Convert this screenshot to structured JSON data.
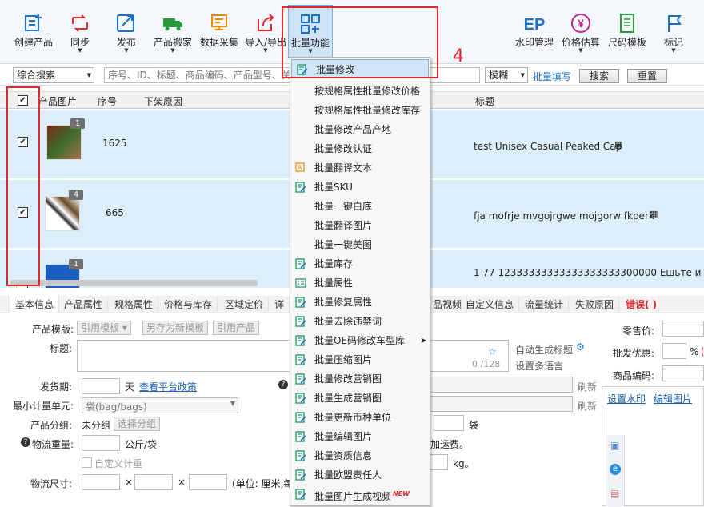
{
  "toolbar": {
    "items": [
      {
        "label": "创建产品",
        "icon": "create-product-icon",
        "dropdown": false
      },
      {
        "label": "同步",
        "icon": "sync-icon",
        "dropdown": true
      },
      {
        "label": "发布",
        "icon": "publish-icon",
        "dropdown": true
      },
      {
        "label": "产品搬家",
        "icon": "truck-icon",
        "dropdown": true
      },
      {
        "label": "数据采集",
        "icon": "data-collect-icon",
        "dropdown": false
      },
      {
        "label": "导入/导出",
        "icon": "import-export-icon",
        "dropdown": true
      },
      {
        "label": "批量功能",
        "icon": "batch-function-icon",
        "dropdown": true
      },
      {
        "label": "水印管理",
        "icon": "watermark-icon",
        "dropdown": false
      },
      {
        "label": "价格估算",
        "icon": "yen-icon",
        "dropdown": true
      },
      {
        "label": "尺码模板",
        "icon": "size-template-icon",
        "dropdown": false
      },
      {
        "label": "标记",
        "icon": "flag-icon",
        "dropdown": true
      }
    ]
  },
  "search": {
    "type_value": "综合搜索",
    "placeholder": "序号、ID、标题、商品编码、产品型号、关",
    "mode_value": "模糊",
    "batch_fill_link": "批量填写",
    "search_button": "搜索",
    "reset_button": "重置"
  },
  "grid": {
    "headers": [
      "产品图片",
      "序号",
      "下架原因",
      "标题"
    ],
    "rows": [
      {
        "checked": true,
        "badge": "1",
        "seq": "1625",
        "title": "test Unisex Casual Peaked Cap"
      },
      {
        "checked": true,
        "badge": "4",
        "seq": "665",
        "title": "fja mofrje mvgojrgwe mojgorw fkperk"
      },
      {
        "checked": false,
        "badge": "1",
        "seq": "",
        "title": "1 77 12333333333333333333300000  Ешьте и"
      }
    ]
  },
  "tabs": [
    {
      "label": "基本信息"
    },
    {
      "label": "产品属性"
    },
    {
      "label": "规格属性"
    },
    {
      "label": "价格与库存"
    },
    {
      "label": "区域定价"
    },
    {
      "label": "详"
    },
    {
      "label": "品视频"
    },
    {
      "label": "自定义信息"
    },
    {
      "label": "流量统计"
    },
    {
      "label": "失败原因"
    },
    {
      "label": "错误( )"
    }
  ],
  "form": {
    "template_label": "产品模版:",
    "ref_template_button": "引用模板",
    "save_template_button": "另存为新模板",
    "ref_product_button": "引用产品",
    "title_label": "标题:",
    "title_counter": "0 /128",
    "auto_title_label": "自动生成标题",
    "multi_lang_label": "设置多语言",
    "delivery_label": "发货期:",
    "delivery_unit": "天",
    "platform_policy_link": "查看平台政策",
    "min_unit_label": "最小计量单元:",
    "min_unit_value": "袋(bag/bags)",
    "group_label": "产品分组:",
    "group_value": "未分组",
    "choose_group_button": "选择分组",
    "weight_label": "物流重量:",
    "weight_unit": "公斤/袋",
    "custom_weight_label": "自定义计重",
    "size_label": "物流尺寸:",
    "size_times1": "×",
    "size_times2": "×",
    "size_unit": "(单位: 厘米,每",
    "refresh1": "刷新",
    "refresh2": "刷新",
    "bag_unit": "袋",
    "shipping_fee_text": "加运费。",
    "kg_unit": "kg。",
    "retail_price_label": "零售价:",
    "wholesale_label": "批发优惠:",
    "percent": "%",
    "percent_paren": "(",
    "product_code_label": "商品编码:",
    "set_watermark_link": "设置水印",
    "edit_image_link": "编辑图片"
  },
  "batch_menu": {
    "items": [
      {
        "label": "批量修改",
        "icon": "edit-doc-icon"
      },
      {
        "label": "按规格属性批量修改价格",
        "icon": ""
      },
      {
        "label": "按规格属性批量修改库存",
        "icon": ""
      },
      {
        "label": "批量修改产品产地",
        "icon": ""
      },
      {
        "label": "批量修改认证",
        "icon": ""
      },
      {
        "label": "批量翻译文本",
        "icon": "translate-icon"
      },
      {
        "label": "批量SKU",
        "icon": "edit-doc-icon"
      },
      {
        "label": "批量一键白底",
        "icon": ""
      },
      {
        "label": "批量翻译图片",
        "icon": ""
      },
      {
        "label": "批量一键美图",
        "icon": ""
      },
      {
        "label": "批量库存",
        "icon": "edit-doc-icon"
      },
      {
        "label": "批量属性",
        "icon": "attribute-icon"
      },
      {
        "label": "批量修复属性",
        "icon": "edit-doc-icon"
      },
      {
        "label": "批量去除违禁词",
        "icon": "edit-doc-icon"
      },
      {
        "label": "批量OE码修改车型库",
        "icon": "edit-doc-icon",
        "submenu": true
      },
      {
        "label": "批量压缩图片",
        "icon": "edit-doc-icon"
      },
      {
        "label": "批量修改营销图",
        "icon": "edit-doc-icon"
      },
      {
        "label": "批量生成营销图",
        "icon": "edit-doc-icon"
      },
      {
        "label": "批量更新币种单位",
        "icon": "edit-doc-icon"
      },
      {
        "label": "批量编辑图片",
        "icon": "edit-doc-icon"
      },
      {
        "label": "批量资质信息",
        "icon": "edit-doc-icon"
      },
      {
        "label": "批量欧盟责任人",
        "icon": "edit-doc-icon"
      },
      {
        "label": "批量图片生成视频",
        "icon": "edit-doc-icon",
        "badge": "NEW"
      }
    ]
  },
  "annotation": {
    "step": "4"
  },
  "colors": {
    "accent": "#1a73c8",
    "highlight_red": "#e0282e",
    "row_selected": "#dbeefa"
  }
}
